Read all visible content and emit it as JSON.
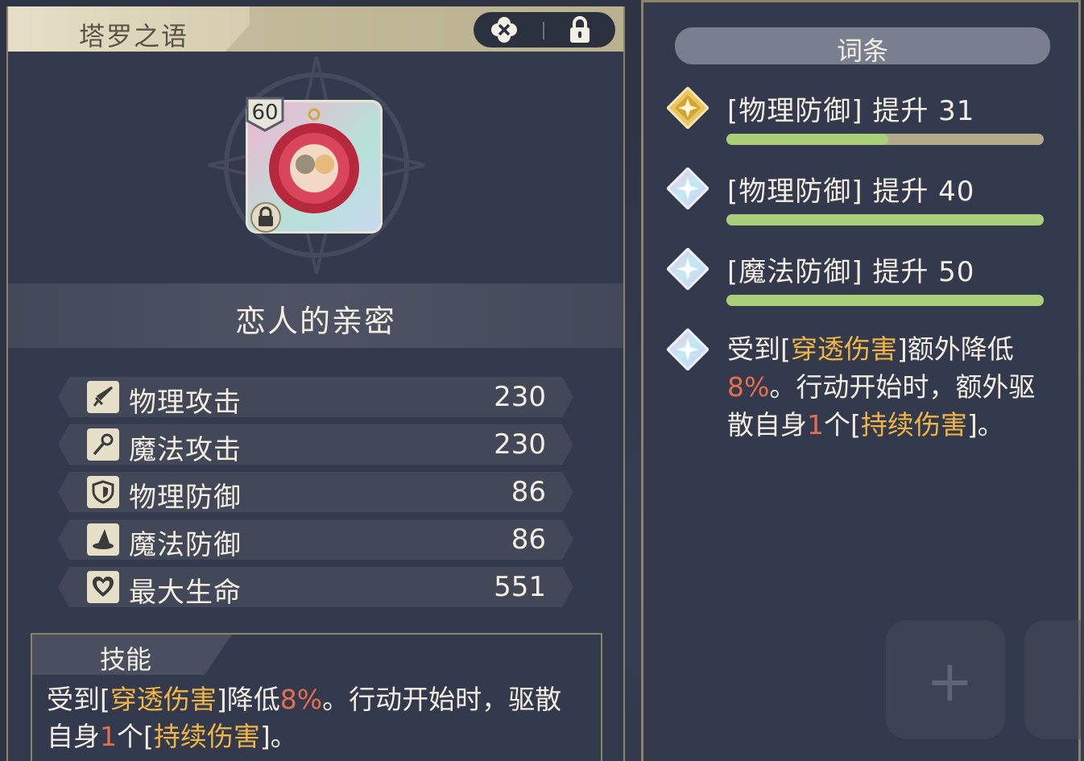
{
  "left": {
    "title": "塔罗之语",
    "card": {
      "level": "60",
      "name": "恋人的亲密"
    },
    "stats": [
      {
        "label": "物理攻击",
        "value": "230",
        "icon": "sword-icon"
      },
      {
        "label": "魔法攻击",
        "value": "230",
        "icon": "staff-icon"
      },
      {
        "label": "物理防御",
        "value": "86",
        "icon": "shield-icon"
      },
      {
        "label": "魔法防御",
        "value": "86",
        "icon": "wizard-hat-icon"
      },
      {
        "label": "最大生命",
        "value": "551",
        "icon": "heart-icon"
      }
    ],
    "skill": {
      "title": "技能",
      "text_parts": [
        "受到[",
        "穿透伤害",
        "]降低",
        "8%",
        "。行动开始时，驱散自身",
        "1",
        "个[",
        "持续伤害",
        "]。"
      ]
    }
  },
  "right": {
    "header": "词条",
    "entries": [
      {
        "text": "[物理防御] 提升 31",
        "fill": 0.51,
        "gem": "gold"
      },
      {
        "text": "[物理防御] 提升 40",
        "fill": 1.0,
        "gem": "prism"
      },
      {
        "text": "[魔法防御] 提升 50",
        "fill": 1.0,
        "gem": "prism"
      }
    ],
    "desc_parts": [
      "受到[",
      "穿透伤害",
      "]额外降低",
      "8%",
      "。行动开始时，额外驱散自身",
      "1",
      "个[",
      "持续伤害",
      "]。"
    ]
  },
  "colors": {
    "highlight_gold": "#f0b546",
    "highlight_red": "#e66d4d",
    "bar_fill": "#a9cf7a"
  }
}
